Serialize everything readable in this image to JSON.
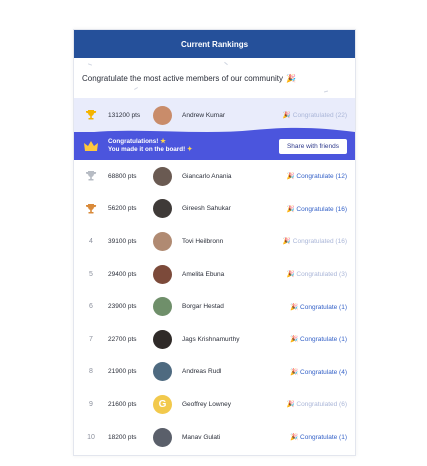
{
  "header": {
    "title": "Current Rankings"
  },
  "intro": {
    "text": "Congratulate the most active members of our community",
    "emoji": "🎉"
  },
  "current_user": {
    "rank": "1",
    "points": "131200 pts",
    "name": "Andrew Kumar",
    "congrats_label": "🎉 Congratulated (22)",
    "avatar_color": "#c98c6a"
  },
  "banner": {
    "line1": "Congratulations!",
    "line2": "You made it on the board!",
    "share_label": "Share with friends"
  },
  "rows": [
    {
      "rank": "2",
      "points": "68800 pts",
      "name": "Giancarlo Anania",
      "congrats_label": "🎉 Congratulate (12)",
      "done": false,
      "avatar_color": "#6a5a52",
      "initial": ""
    },
    {
      "rank": "3",
      "points": "56200 pts",
      "name": "Gireesh Sahukar",
      "congrats_label": "🎉 Congratulate (16)",
      "done": false,
      "avatar_color": "#3f3a38",
      "initial": ""
    },
    {
      "rank": "4",
      "points": "39100 pts",
      "name": "Tovi Heilbronn",
      "congrats_label": "🎉 Congratulated (16)",
      "done": true,
      "avatar_color": "#b08a72",
      "initial": ""
    },
    {
      "rank": "5",
      "points": "29400 pts",
      "name": "Amelita Ebuna",
      "congrats_label": "🎉 Congratulated (3)",
      "done": true,
      "avatar_color": "#7c4a3a",
      "initial": ""
    },
    {
      "rank": "6",
      "points": "23900 pts",
      "name": "Borgar Hestad",
      "congrats_label": "🎉 Congratulate (1)",
      "done": false,
      "avatar_color": "#6f8f6a",
      "initial": ""
    },
    {
      "rank": "7",
      "points": "22700 pts",
      "name": "Jags Krishnamurthy",
      "congrats_label": "🎉 Congratulate (1)",
      "done": false,
      "avatar_color": "#2f2a28",
      "initial": ""
    },
    {
      "rank": "8",
      "points": "21900 pts",
      "name": "Andreas Rudl",
      "congrats_label": "🎉 Congratulate (4)",
      "done": false,
      "avatar_color": "#4e6a80",
      "initial": ""
    },
    {
      "rank": "9",
      "points": "21600 pts",
      "name": "Geoffrey Lowney",
      "congrats_label": "🎉 Congratulated (6)",
      "done": true,
      "avatar_color": "#f2c94c",
      "initial": "G"
    },
    {
      "rank": "10",
      "points": "18200 pts",
      "name": "Manav Gulati",
      "congrats_label": "🎉 Congratulate (1)",
      "done": false,
      "avatar_color": "#5a5f6a",
      "initial": ""
    }
  ],
  "colors": {
    "gold": "#f4b400",
    "silver": "#b7bcc4",
    "bronze": "#d98a3a",
    "accent": "#3562c8",
    "header": "#25509a",
    "banner": "#4b55dd"
  }
}
